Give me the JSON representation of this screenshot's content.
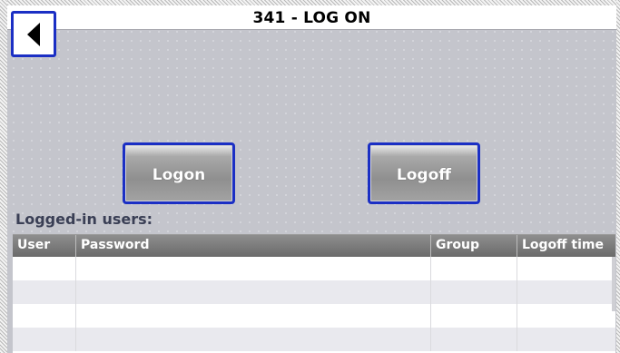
{
  "title": "341 - LOG ON",
  "buttons": {
    "back_icon": "left-triangle-arrow",
    "logon_label": "Logon",
    "logoff_label": "Logoff"
  },
  "users_section": {
    "label": "Logged-in users:",
    "columns": [
      "User",
      "Password",
      "Group",
      "Logoff time"
    ],
    "rows": [
      [
        "",
        "",
        "",
        ""
      ],
      [
        "",
        "",
        "",
        ""
      ],
      [
        "",
        "",
        "",
        ""
      ],
      [
        "",
        "",
        "",
        ""
      ]
    ]
  },
  "colors": {
    "button_border": "#1b2fc4",
    "background": "#c4c5cc",
    "table_header": "#7a7a7a"
  }
}
